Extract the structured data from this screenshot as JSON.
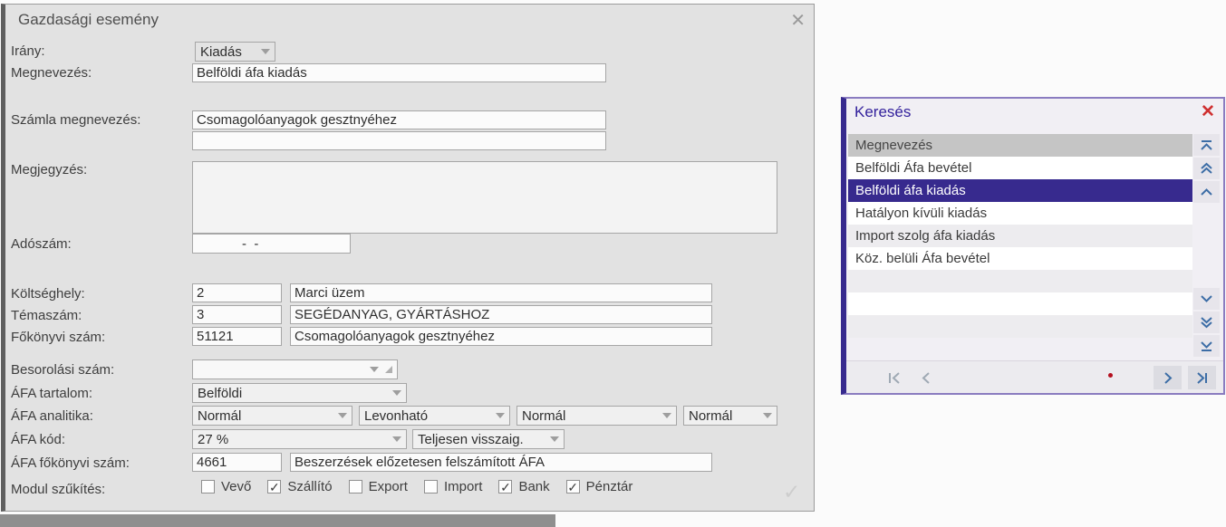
{
  "window": {
    "title": "Gazdasági esemény",
    "close_icon": "✕"
  },
  "form": {
    "irany": {
      "label": "Irány:",
      "value": "Kiadás"
    },
    "megnevezes": {
      "label": "Megnevezés:",
      "value": "Belföldi áfa kiadás"
    },
    "szamla_megnevezes": {
      "label": "Számla megnevezés:",
      "value": "Csomagolóanyagok gesztnyéhez",
      "value2": ""
    },
    "megjegyzes": {
      "label": "Megjegyzés:",
      "value": ""
    },
    "adoszam": {
      "label": "Adószám:",
      "value": "-  -"
    },
    "koltseghely": {
      "label": "Költséghely:",
      "code": "2",
      "name": "Marci üzem"
    },
    "temaszam": {
      "label": "Témaszám:",
      "code": "3",
      "name": "SEGÉDANYAG, GYÁRTÁSHOZ"
    },
    "fokonyvi_szam": {
      "label": "Főkönyvi szám:",
      "code": "51121",
      "name": "Csomagolóanyagok gesztnyéhez"
    },
    "besorolasi_szam": {
      "label": "Besorolási szám:",
      "value": ""
    },
    "afa_tartalom": {
      "label": "ÁFA tartalom:",
      "value": "Belföldi"
    },
    "afa_analitika": {
      "label": "ÁFA analitika:",
      "values": [
        "Normál",
        "Levonható",
        "Normál",
        "Normál"
      ]
    },
    "afa_kod": {
      "label": "ÁFA kód:",
      "value": "27 %",
      "value2": "Teljesen visszaig."
    },
    "afa_fokonyvi_szam": {
      "label": "ÁFA főkönyvi szám:",
      "code": "4661",
      "name": "Beszerzések előzetesen felszámított ÁFA"
    },
    "modul_szukites": {
      "label": "Modul szűkítés:",
      "checkboxes": [
        {
          "label": "Vevő",
          "checked": false
        },
        {
          "label": "Szállító",
          "checked": true
        },
        {
          "label": "Export",
          "checked": false
        },
        {
          "label": "Import",
          "checked": false
        },
        {
          "label": "Bank",
          "checked": true
        },
        {
          "label": "Pénztár",
          "checked": true
        }
      ]
    }
  },
  "search_panel": {
    "title": "Keresés",
    "close_icon": "✕",
    "column_header": "Megnevezés",
    "items": [
      "Belföldi Áfa bevétel",
      "Belföldi áfa kiadás",
      "Hatályon kívüli kiadás",
      "Import szolg áfa kiadás",
      "Köz. belüli Áfa bevétel"
    ],
    "selected_item": "Belföldi áfa kiadás"
  },
  "colors": {
    "selection_purple": "#372a8e",
    "title_purple": "#33219c",
    "close_red": "#cf3030",
    "scroll_blue": "#3c6da6",
    "dialog_bg": "#e2e2e2"
  }
}
